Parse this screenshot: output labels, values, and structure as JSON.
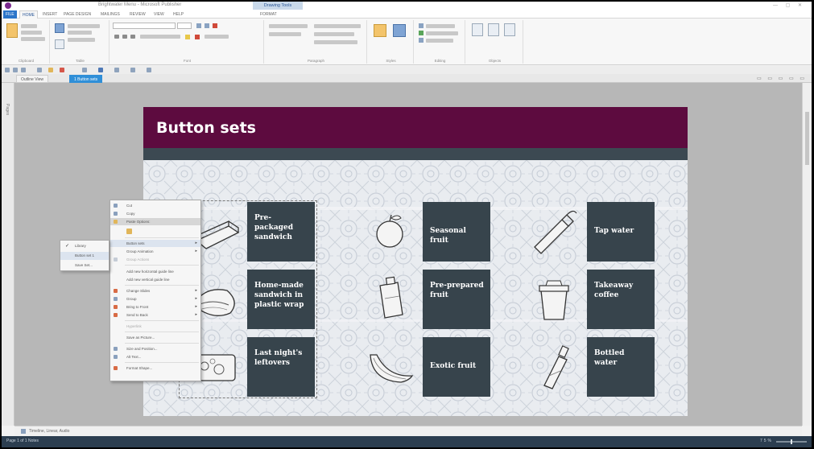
{
  "window": {
    "title": "Brightwater Menu - Microsoft Publisher",
    "context_tab": "Drawing Tools"
  },
  "ribbon": {
    "tabs": [
      "FILE",
      "HOME",
      "INSERT",
      "PAGE DESIGN",
      "MAILINGS",
      "REVIEW",
      "VIEW",
      "HELP",
      "FORMAT"
    ],
    "active_tab": "HOME",
    "groups": [
      "Clipboard",
      "Table",
      "Font",
      "Paragraph",
      "Styles",
      "Editing",
      "Objects",
      "Arrange"
    ]
  },
  "doc_tabs": [
    "Outline View",
    "1 Button sets"
  ],
  "page": {
    "title": "Button sets",
    "cards": [
      {
        "label": "Pre-packaged sandwich",
        "illustration": "sandwich-box-icon"
      },
      {
        "label": "Seasonal fruit",
        "illustration": "apple-icon"
      },
      {
        "label": "Tap water",
        "illustration": "water-bottle-icon"
      },
      {
        "label": "Home-made sandwich in plastic wrap",
        "illustration": "wrapped-sandwich-icon"
      },
      {
        "label": "Pre-prepared fruit",
        "illustration": "fruit-pouch-icon"
      },
      {
        "label": "Takeaway coffee",
        "illustration": "coffee-cup-icon"
      },
      {
        "label": "Last night's leftovers",
        "illustration": "leftovers-container-icon"
      },
      {
        "label": "Exotic fruit",
        "illustration": "banana-icon"
      },
      {
        "label": "Bottled water",
        "illustration": "plastic-bottle-icon"
      }
    ]
  },
  "context_menu": {
    "items": [
      "Cut",
      "Copy",
      "Paste Options:",
      "",
      "Button sets",
      "Group Animation",
      "Group Actions",
      "Add new horizontal guide line",
      "Add new vertical guide line",
      "Change Slides",
      "Group",
      "Bring to Front",
      "Send to Back",
      "Hyperlink",
      "Save as Picture...",
      "Size and Position...",
      "Alt Text...",
      "Format Shape..."
    ],
    "submenu": [
      "Library",
      "Button set 1",
      "Save Set..."
    ]
  },
  "notes_bar": {
    "text": "Timeline, Linear, Audio"
  },
  "status": {
    "left": "Page 1 of 1   Notes",
    "zoom": "75%"
  }
}
